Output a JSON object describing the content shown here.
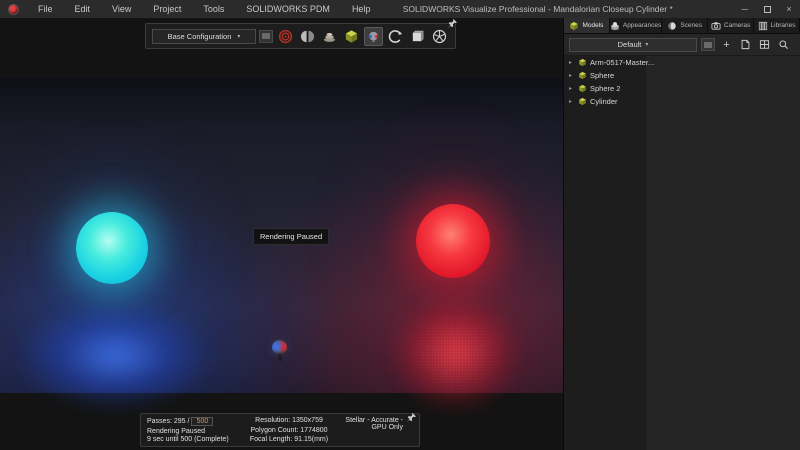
{
  "window": {
    "title": "SOLIDWORKS Visualize Professional - Mandalorian Closeup Cylinder *",
    "menus": [
      "File",
      "Edit",
      "View",
      "Project",
      "Tools",
      "SOLIDWORKS PDM",
      "Help"
    ]
  },
  "icons": {
    "minimize": "─",
    "close": "×",
    "dropdown_arrow": "▾",
    "tree_arrow": "▸",
    "plus": "+"
  },
  "viewport_toolbar": {
    "config_dropdown_value": "Base Configuration",
    "buttons": [
      "render",
      "compare-split",
      "render-queue",
      "model-set",
      "denoiser",
      "turntable",
      "snapshot",
      "camera-effects"
    ],
    "selected_button": "denoiser"
  },
  "viewport": {
    "paused_label": "Rendering Paused",
    "colors": {
      "sphere_left": "#2ee6e2",
      "sphere_right": "#f2202f",
      "glow_left": "#2a50d8",
      "glow_right": "#d81f32",
      "background": "#232334"
    }
  },
  "render_status": {
    "passes_label": "Passes: 295 /",
    "passes_limit": "500",
    "state": "Rendering Paused",
    "eta": "9 sec until 500 (Complete)",
    "resolution": "Resolution: 1350x759",
    "polygons": "Polygon Count: 1774800",
    "focal_length": "Focal Length: 91.15(mm)",
    "render_mode": "Stellar - Accurate - GPU Only",
    "passes_value_color": "#c89a62"
  },
  "right_panel": {
    "tabs": [
      {
        "label": "Models",
        "selected": true
      },
      {
        "label": "Appearances",
        "selected": false
      },
      {
        "label": "Scenes",
        "selected": false
      },
      {
        "label": "Cameras",
        "selected": false
      },
      {
        "label": "Libraries",
        "selected": false
      }
    ],
    "preset_dropdown_value": "Default",
    "tree": [
      {
        "label": "Arm-0517-Master..."
      },
      {
        "label": "Sphere"
      },
      {
        "label": "Sphere 2"
      },
      {
        "label": "Cylinder"
      }
    ]
  }
}
